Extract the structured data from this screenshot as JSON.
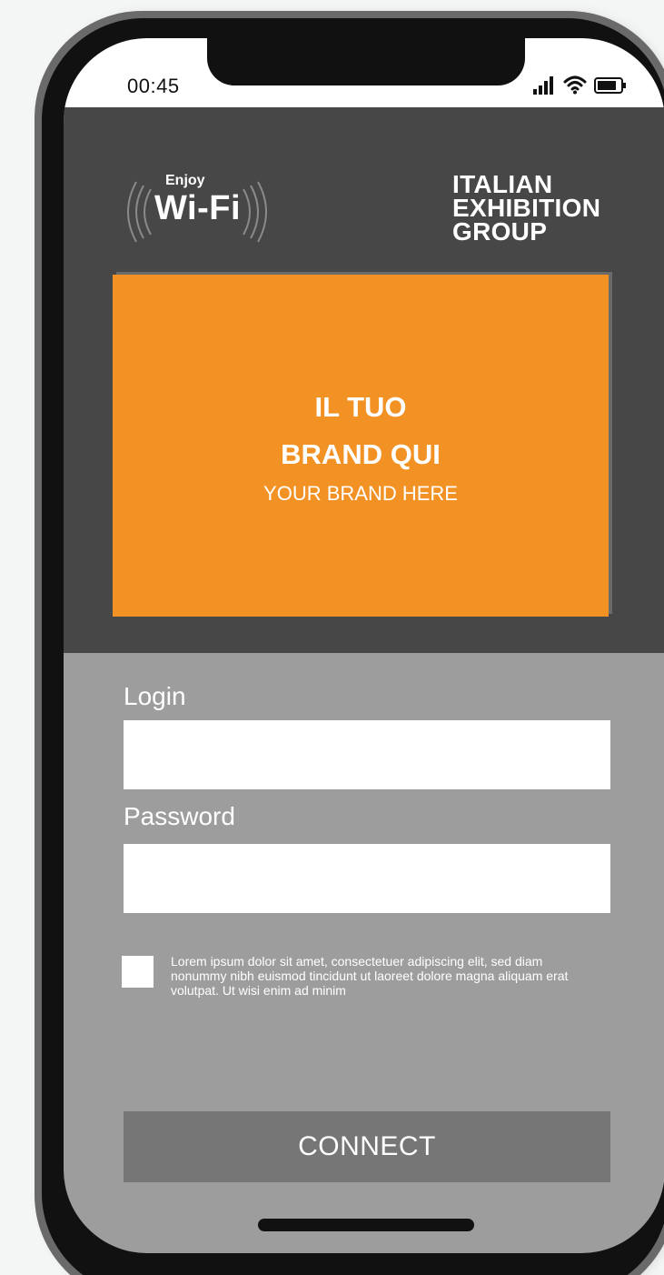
{
  "status_bar": {
    "time": "00:45"
  },
  "header": {
    "wifi_logo": {
      "small": "Enjoy",
      "large": "Wi-Fi"
    },
    "ieg_logo": {
      "line1": "ITALIAN",
      "line2": "EXHIBITION",
      "line3": "GROUP"
    },
    "brand": {
      "line1": "IL TUO",
      "line2": "BRAND QUI",
      "line3": "YOUR BRAND HERE",
      "color": "#f39224"
    }
  },
  "form": {
    "login_label": "Login",
    "login_value": "",
    "password_label": "Password",
    "password_value": "",
    "terms_text": "Lorem ipsum dolor sit amet, consectetuer adipiscing elit, sed diam nonummy nibh euismod tincidunt ut laoreet dolore magna aliquam erat volutpat. Ut wisi enim ad minim",
    "terms_checked": false,
    "connect_label": "CONNECT"
  },
  "colors": {
    "header_bg": "#474747",
    "form_bg": "#9d9d9d",
    "button_bg": "#767676"
  }
}
